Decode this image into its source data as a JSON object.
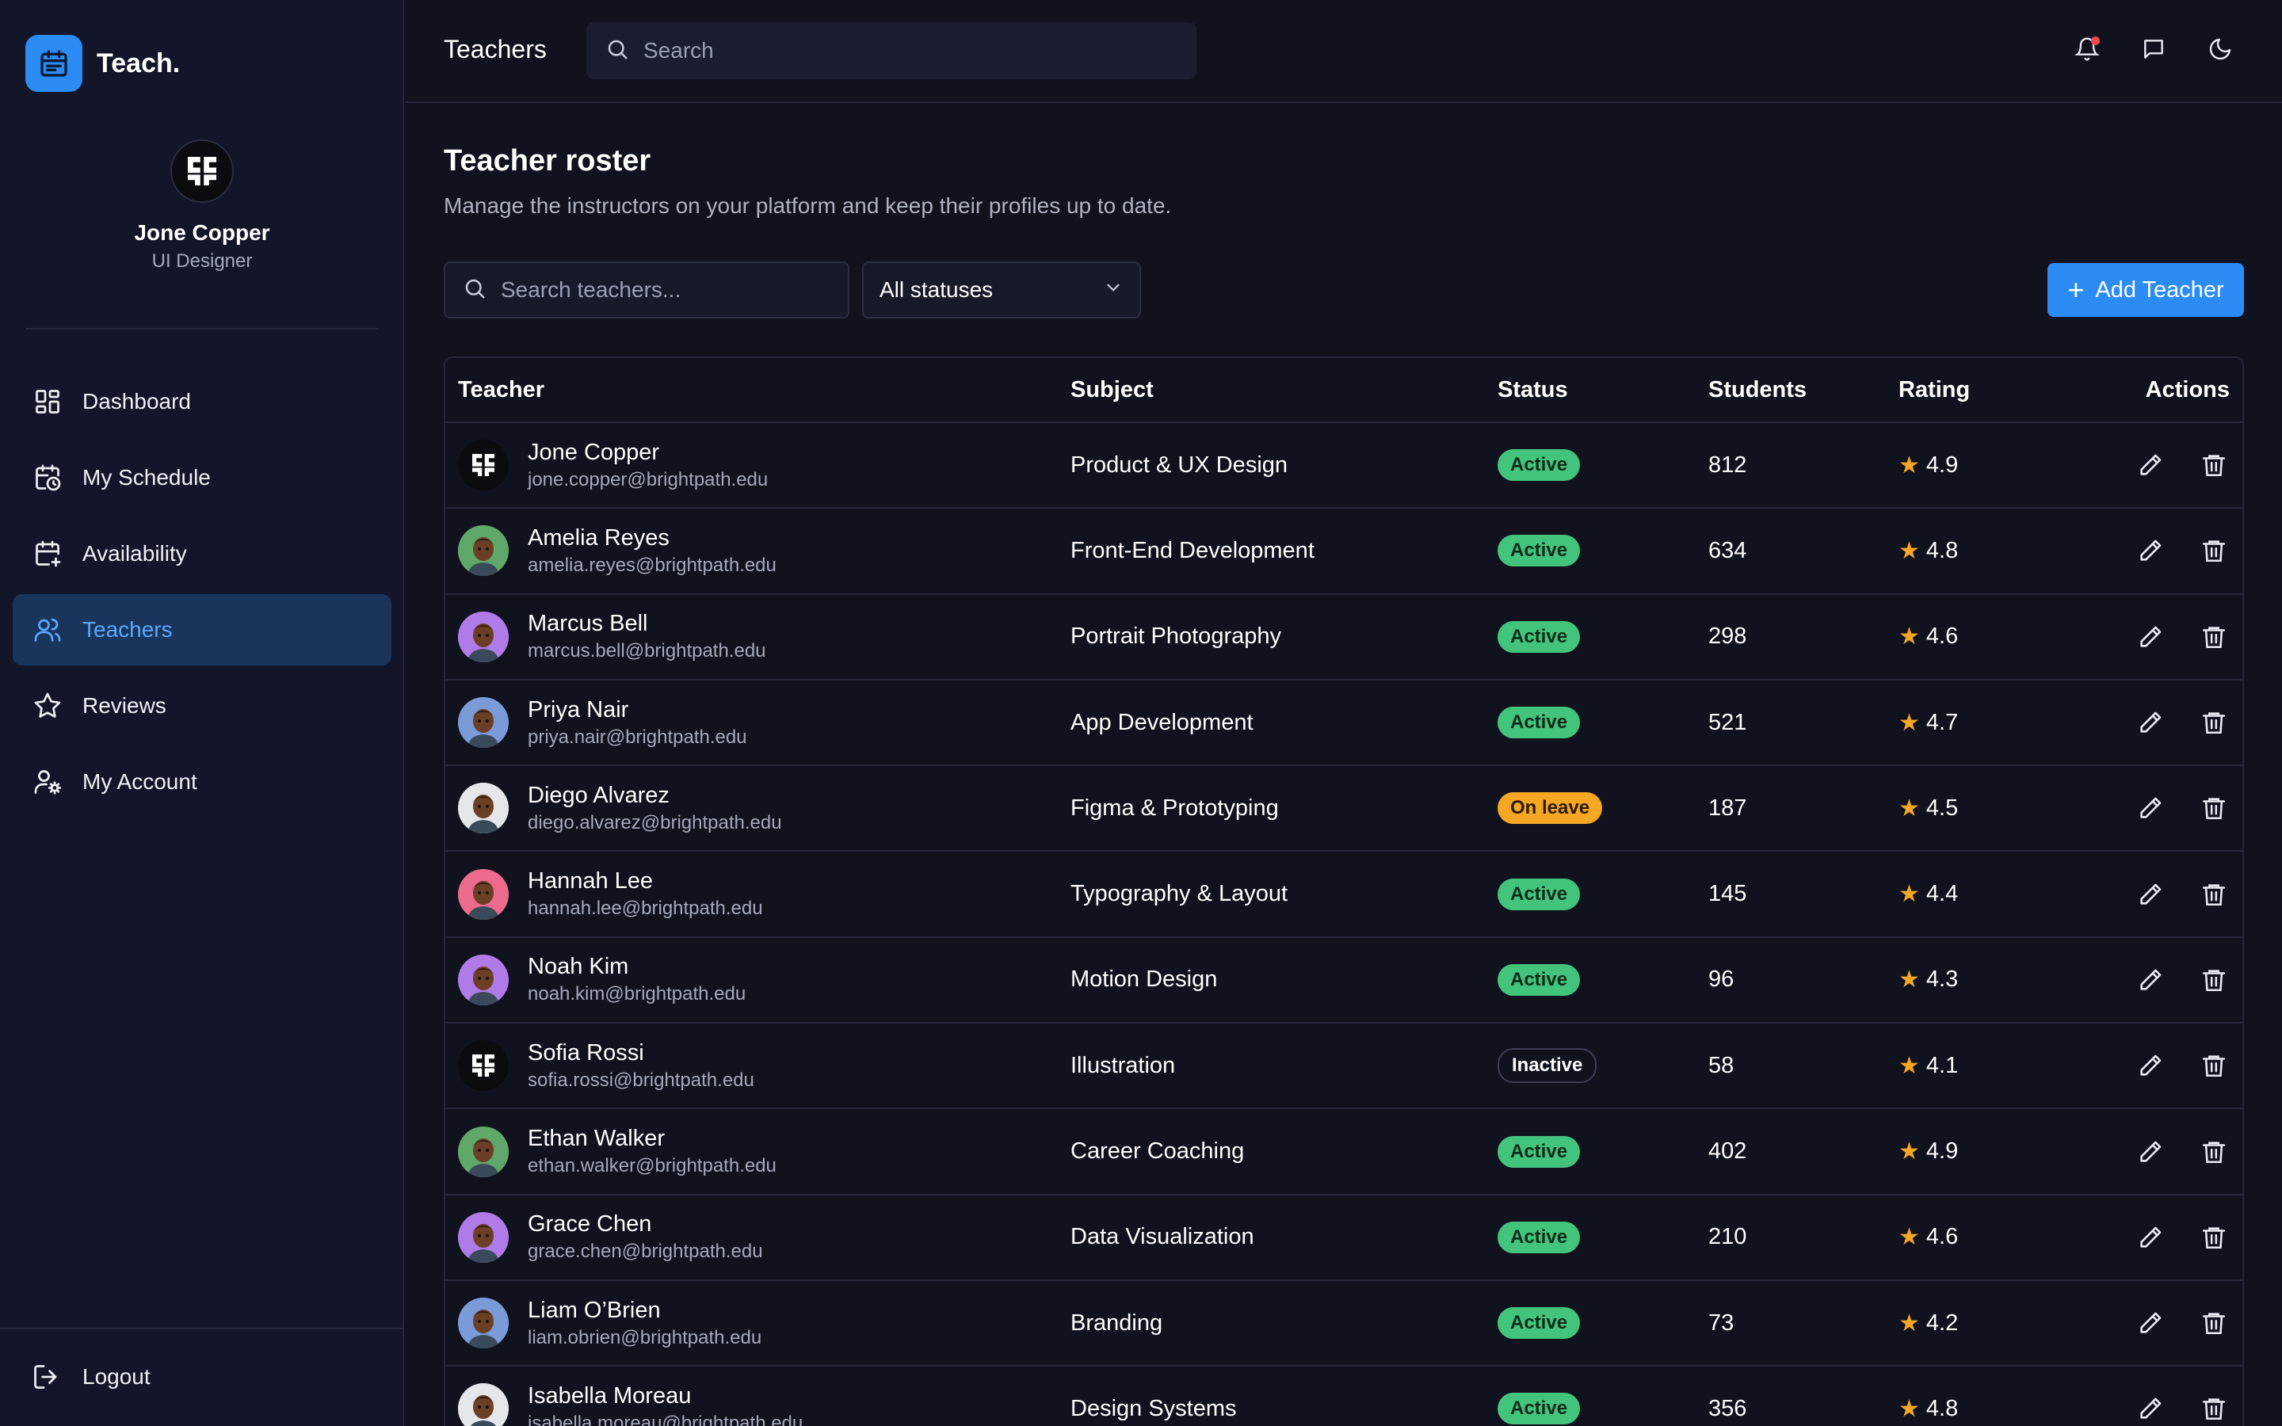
{
  "brand": {
    "name": "Teach."
  },
  "profile": {
    "name": "Jone Copper",
    "role": "UI Designer"
  },
  "nav": [
    {
      "label": "Dashboard",
      "icon": "dashboard-icon"
    },
    {
      "label": "My Schedule",
      "icon": "calendar-clock-icon"
    },
    {
      "label": "Availability",
      "icon": "calendar-plus-icon"
    },
    {
      "label": "Teachers",
      "icon": "users-icon",
      "active": true
    },
    {
      "label": "Reviews",
      "icon": "star-icon"
    },
    {
      "label": "My Account",
      "icon": "user-settings-icon"
    }
  ],
  "logout_label": "Logout",
  "topbar": {
    "title": "Teachers",
    "search_placeholder": "Search"
  },
  "roster": {
    "title": "Teacher roster",
    "subtitle": "Manage the instructors on your platform and keep their profiles up to date.",
    "search_placeholder": "Search teachers...",
    "status_filter": "All statuses",
    "add_label": "Add Teacher"
  },
  "table": {
    "headers": {
      "teacher": "Teacher",
      "subject": "Subject",
      "status": "Status",
      "students": "Students",
      "rating": "Rating",
      "actions": "Actions"
    },
    "rows": [
      {
        "name": "Jone Copper",
        "email": "jone.copper@brightpath.edu",
        "subject": "Product & UX Design",
        "status": "Active",
        "students": "812",
        "rating": "4.9",
        "avatar_color": "#0b0b10",
        "avatar_kind": "logo"
      },
      {
        "name": "Amelia Reyes",
        "email": "amelia.reyes@brightpath.edu",
        "subject": "Front-End Development",
        "status": "Active",
        "students": "634",
        "rating": "4.8",
        "avatar_color": "#5fa86a",
        "avatar_kind": "person"
      },
      {
        "name": "Marcus Bell",
        "email": "marcus.bell@brightpath.edu",
        "subject": "Portrait Photography",
        "status": "Active",
        "students": "298",
        "rating": "4.6",
        "avatar_color": "#b07ae8",
        "avatar_kind": "person"
      },
      {
        "name": "Priya Nair",
        "email": "priya.nair@brightpath.edu",
        "subject": "App Development",
        "status": "Active",
        "students": "521",
        "rating": "4.7",
        "avatar_color": "#7a9ad8",
        "avatar_kind": "person"
      },
      {
        "name": "Diego Alvarez",
        "email": "diego.alvarez@brightpath.edu",
        "subject": "Figma & Prototyping",
        "status": "On leave",
        "students": "187",
        "rating": "4.5",
        "avatar_color": "#e4e6ea",
        "avatar_kind": "person"
      },
      {
        "name": "Hannah Lee",
        "email": "hannah.lee@brightpath.edu",
        "subject": "Typography & Layout",
        "status": "Active",
        "students": "145",
        "rating": "4.4",
        "avatar_color": "#ec6a8e",
        "avatar_kind": "person"
      },
      {
        "name": "Noah Kim",
        "email": "noah.kim@brightpath.edu",
        "subject": "Motion Design",
        "status": "Active",
        "students": "96",
        "rating": "4.3",
        "avatar_color": "#b07ae8",
        "avatar_kind": "person"
      },
      {
        "name": "Sofia Rossi",
        "email": "sofia.rossi@brightpath.edu",
        "subject": "Illustration",
        "status": "Inactive",
        "students": "58",
        "rating": "4.1",
        "avatar_color": "#0b0b10",
        "avatar_kind": "logo"
      },
      {
        "name": "Ethan Walker",
        "email": "ethan.walker@brightpath.edu",
        "subject": "Career Coaching",
        "status": "Active",
        "students": "402",
        "rating": "4.9",
        "avatar_color": "#5fa86a",
        "avatar_kind": "person"
      },
      {
        "name": "Grace Chen",
        "email": "grace.chen@brightpath.edu",
        "subject": "Data Visualization",
        "status": "Active",
        "students": "210",
        "rating": "4.6",
        "avatar_color": "#b07ae8",
        "avatar_kind": "person"
      },
      {
        "name": "Liam O’Brien",
        "email": "liam.obrien@brightpath.edu",
        "subject": "Branding",
        "status": "Active",
        "students": "73",
        "rating": "4.2",
        "avatar_color": "#7a9ad8",
        "avatar_kind": "person"
      },
      {
        "name": "Isabella Moreau",
        "email": "isabella.moreau@brightpath.edu",
        "subject": "Design Systems",
        "status": "Active",
        "students": "356",
        "rating": "4.8",
        "avatar_color": "#e4e6ea",
        "avatar_kind": "person"
      }
    ]
  },
  "colors": {
    "accent": "#2b8cf5",
    "active": "#43c47c",
    "on_leave": "#f5a623",
    "star": "#f5a623"
  }
}
